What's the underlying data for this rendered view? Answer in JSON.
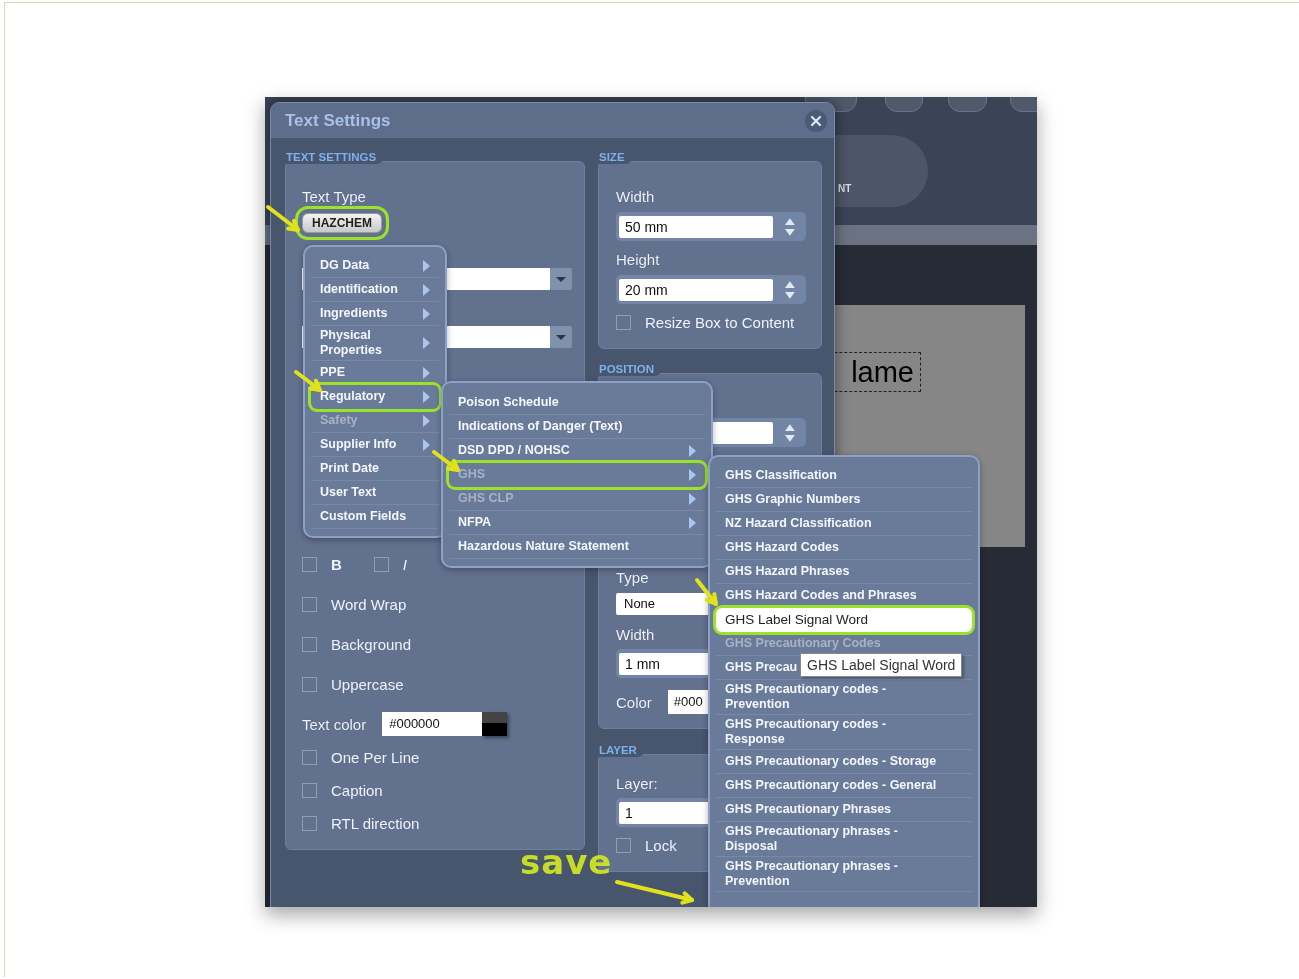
{
  "dialog": {
    "title": "Text Settings"
  },
  "text_settings": {
    "header": "TEXT SETTINGS",
    "text_type_label": "Text Type",
    "text_type": {
      "label": "HAZCHEM",
      "selected": true
    },
    "style_toggles": [
      {
        "kind": "bold",
        "label": "B",
        "checked": false
      },
      {
        "kind": "italic",
        "label": "I",
        "checked": false
      }
    ],
    "options": [
      {
        "label": "Word Wrap",
        "checked": false
      },
      {
        "label": "Background",
        "checked": false
      },
      {
        "label": "Uppercase",
        "checked": false
      }
    ],
    "text_color": {
      "label": "Text color",
      "value": "#000000"
    },
    "options_after": [
      {
        "label": "One Per Line",
        "checked": false
      },
      {
        "label": "Caption",
        "checked": false
      },
      {
        "label": "RTL direction",
        "checked": false
      }
    ]
  },
  "size": {
    "header": "SIZE",
    "width_label": "Width",
    "width": "50 mm",
    "height_label": "Height",
    "height": "20 mm",
    "resize": {
      "label": "Resize Box to Content",
      "checked": false
    }
  },
  "position": {
    "header": "POSITION",
    "border_type_label": "Type",
    "border_type": "None",
    "border_width_label": "Width",
    "border_width": "1 mm",
    "border_color_label": "Color",
    "border_color": "#000"
  },
  "layer": {
    "header": "LAYER",
    "label": "Layer:",
    "value": "1",
    "lock": {
      "label": "Lock",
      "checked": false
    }
  },
  "menus": [
    {
      "items": [
        {
          "label": "DG Data",
          "submenu": true,
          "selected": false,
          "disabled": false
        },
        {
          "label": "Identification",
          "submenu": true,
          "selected": false,
          "disabled": false
        },
        {
          "label": "Ingredients",
          "submenu": true,
          "selected": false,
          "disabled": false
        },
        {
          "label": "Physical Properties",
          "submenu": true,
          "selected": false,
          "disabled": false
        },
        {
          "label": "PPE",
          "submenu": true,
          "selected": false,
          "disabled": false
        },
        {
          "label": "Regulatory",
          "submenu": true,
          "selected": true,
          "disabled": false
        },
        {
          "label": "Safety",
          "submenu": true,
          "selected": false,
          "disabled": true
        },
        {
          "label": "Supplier Info",
          "submenu": true,
          "selected": false,
          "disabled": false
        },
        {
          "label": "Print Date",
          "submenu": false,
          "selected": false,
          "disabled": false
        },
        {
          "label": "User Text",
          "submenu": false,
          "selected": false,
          "disabled": false
        },
        {
          "label": "Custom Fields",
          "submenu": false,
          "selected": false,
          "disabled": false
        }
      ]
    },
    {
      "items": [
        {
          "label": "Poison Schedule",
          "submenu": false,
          "selected": false,
          "disabled": false
        },
        {
          "label": "Indications of Danger (Text)",
          "submenu": false,
          "selected": false,
          "disabled": false
        },
        {
          "label": "DSD DPD / NOHSC",
          "submenu": true,
          "selected": false,
          "disabled": false
        },
        {
          "label": "GHS",
          "submenu": true,
          "selected": true,
          "disabled": true
        },
        {
          "label": "GHS CLP",
          "submenu": true,
          "selected": false,
          "disabled": true
        },
        {
          "label": "NFPA",
          "submenu": true,
          "selected": false,
          "disabled": false
        },
        {
          "label": "Hazardous Nature Statement",
          "submenu": false,
          "selected": false,
          "disabled": false
        }
      ]
    },
    {
      "items": [
        {
          "label": "GHS Classification",
          "submenu": false,
          "selected": false,
          "disabled": false,
          "highlighted": false
        },
        {
          "label": "GHS Graphic Numbers",
          "submenu": false,
          "selected": false,
          "disabled": false,
          "highlighted": false
        },
        {
          "label": "NZ Hazard Classification",
          "submenu": false,
          "selected": false,
          "disabled": false,
          "highlighted": false
        },
        {
          "label": "GHS Hazard Codes",
          "submenu": false,
          "selected": false,
          "disabled": false,
          "highlighted": false
        },
        {
          "label": "GHS Hazard Phrases",
          "submenu": false,
          "selected": false,
          "disabled": false,
          "highlighted": false
        },
        {
          "label": "GHS Hazard Codes and Phrases",
          "submenu": false,
          "selected": false,
          "disabled": false,
          "highlighted": false
        },
        {
          "label": "GHS Label Signal Word",
          "submenu": false,
          "selected": true,
          "disabled": false,
          "highlighted": true
        },
        {
          "label": "GHS Precautionary Codes",
          "submenu": false,
          "selected": false,
          "disabled": true,
          "highlighted": false
        },
        {
          "label": "GHS Precau",
          "submenu": false,
          "selected": false,
          "disabled": false,
          "highlighted": false
        },
        {
          "label": "GHS Precautionary codes - Prevention",
          "submenu": false,
          "selected": false,
          "disabled": false,
          "highlighted": false
        },
        {
          "label": "GHS Precautionary codes - Response",
          "submenu": false,
          "selected": false,
          "disabled": false,
          "highlighted": false
        },
        {
          "label": "GHS Precautionary codes - Storage",
          "submenu": false,
          "selected": false,
          "disabled": false,
          "highlighted": false
        },
        {
          "label": "GHS Precautionary codes - General",
          "submenu": false,
          "selected": false,
          "disabled": false,
          "highlighted": false
        },
        {
          "label": "GHS Precautionary Phrases",
          "submenu": false,
          "selected": false,
          "disabled": false,
          "highlighted": false
        },
        {
          "label": "GHS Precautionary phrases - Disposal",
          "submenu": false,
          "selected": false,
          "disabled": false,
          "highlighted": false
        },
        {
          "label": "GHS Precautionary phrases - Prevention",
          "submenu": false,
          "selected": false,
          "disabled": false,
          "highlighted": false
        }
      ]
    }
  ],
  "tooltip": "GHS Label Signal Word",
  "annotation_label": "save",
  "background": {
    "tab_text": "NT",
    "canvas_text": "lame"
  }
}
